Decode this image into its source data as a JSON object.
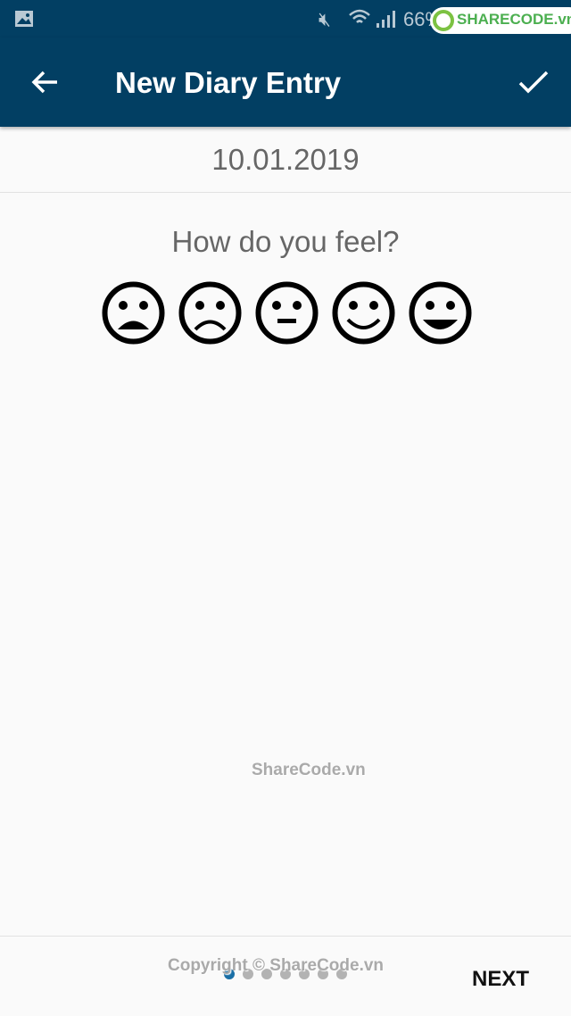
{
  "status_bar": {
    "battery": "66%",
    "watermark_logo": "SHARECODE.vn",
    "icons": [
      "image-icon",
      "mute-icon",
      "wifi-icon",
      "signal-icon"
    ]
  },
  "app_bar": {
    "title": "New Diary Entry",
    "back_icon": "arrow-left-icon",
    "confirm_icon": "check-icon"
  },
  "date": "10.01.2019",
  "question": "How do you feel?",
  "moods": [
    "very-sad",
    "sad",
    "neutral",
    "happy",
    "very-happy"
  ],
  "watermark_center": "ShareCode.vn",
  "watermark_copyright": "Copyright © ShareCode.vn",
  "pager": {
    "count": 7,
    "active": 1,
    "active_color": "#1a6fa6"
  },
  "next_label": "NEXT",
  "colors": {
    "primary": "#023f63"
  }
}
